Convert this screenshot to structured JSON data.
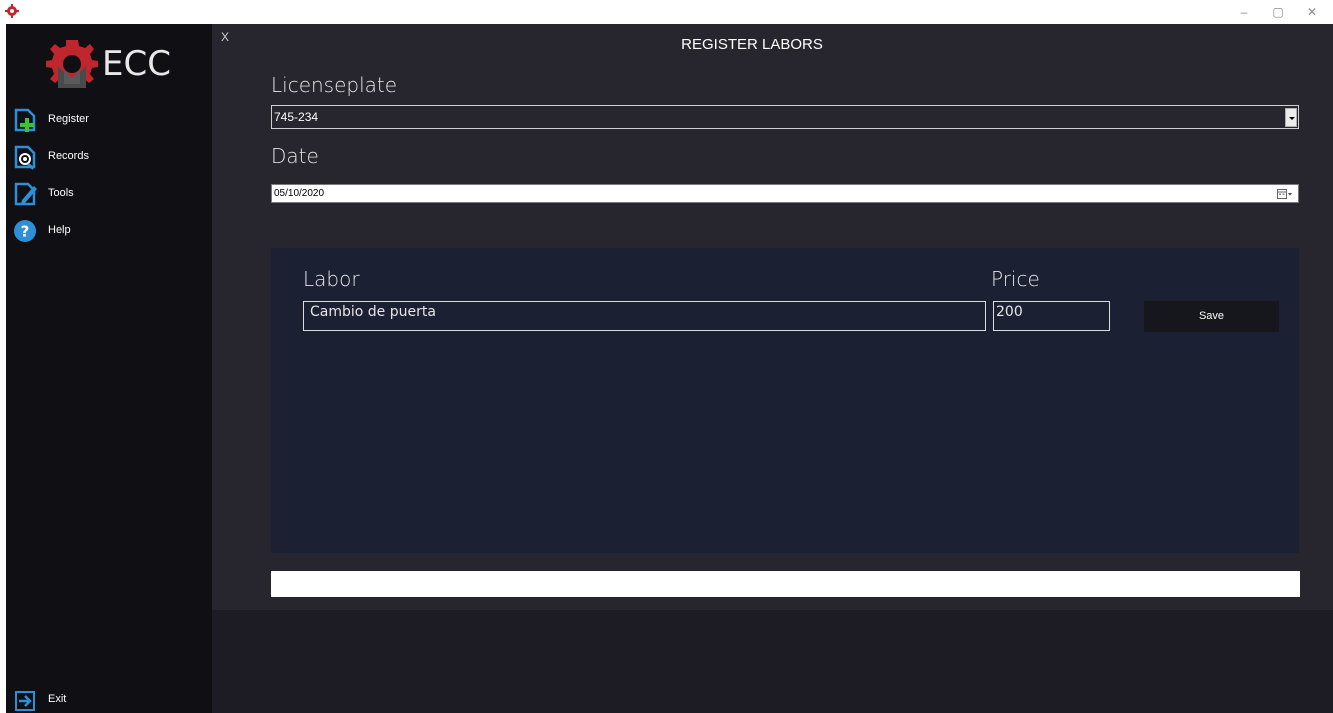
{
  "window": {
    "minimize_glyph": "–",
    "restore_glyph": "▢",
    "close_glyph": "✕"
  },
  "sidebar": {
    "logo_text": "ECC",
    "items": [
      {
        "label": "Register",
        "icon": "register-icon"
      },
      {
        "label": "Records",
        "icon": "records-icon"
      },
      {
        "label": "Tools",
        "icon": "tools-icon"
      },
      {
        "label": "Help",
        "icon": "help-icon"
      }
    ],
    "exit_label": "Exit"
  },
  "main": {
    "close_label": "X",
    "title": "REGISTER LABORS",
    "licenseplate_label": "Licenseplate",
    "licenseplate_value": "745-234",
    "date_label": "Date",
    "date_value": "05/10/2020"
  },
  "card": {
    "labor_label": "Labor",
    "price_label": "Price",
    "labor_value": "Cambio de puerta",
    "price_value": "200",
    "save_label": "Save"
  },
  "colors": {
    "sidebar_bg": "#0f0f14",
    "main_bg": "#27262f",
    "card_bg": "#1c2033",
    "accent_green": "#3cc13b",
    "accent_blue": "#2e8fd6",
    "logo_red": "#d0222b"
  }
}
